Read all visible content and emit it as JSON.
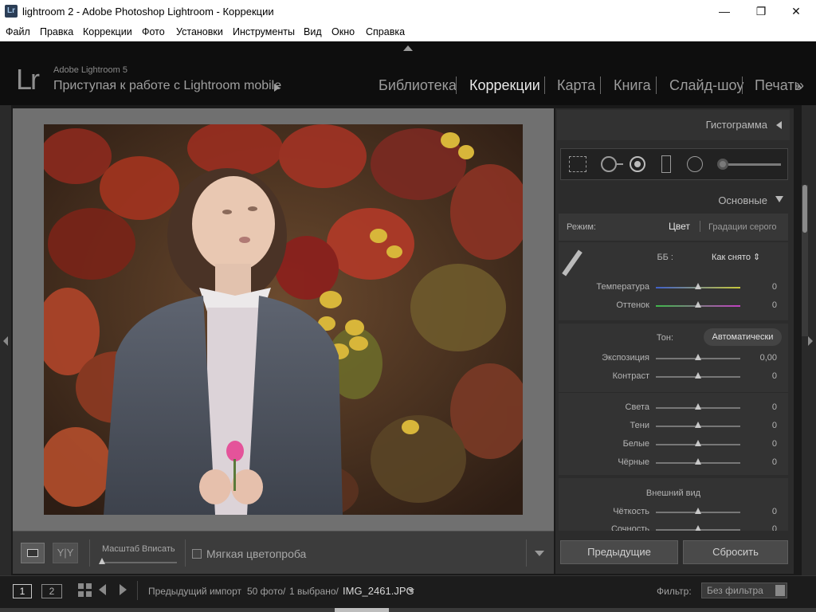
{
  "window": {
    "title": "lightroom 2 - Adobe Photoshop Lightroom - Коррекции",
    "app_icon": "Lr",
    "minimize": "—",
    "maximize": "❐",
    "close": "✕"
  },
  "menu": [
    "Файл",
    "Правка",
    "Коррекции",
    "Фото",
    "Установки",
    "Инструменты",
    "Вид",
    "Окно",
    "Справка"
  ],
  "header": {
    "logo": "Lr",
    "version": "Adobe Lightroom 5",
    "identity": "Приступая к работе с Lightroom mobile",
    "modules": [
      {
        "label": "Библиотека",
        "active": false
      },
      {
        "label": "Коррекции",
        "active": true
      },
      {
        "label": "Карта",
        "active": false
      },
      {
        "label": "Книга",
        "active": false
      },
      {
        "label": "Слайд-шоу",
        "active": false
      },
      {
        "label": "Печать",
        "active": false
      }
    ],
    "more": "»"
  },
  "panel": {
    "histogram_title": "Гистограмма",
    "basic_title": "Основные",
    "treatment": {
      "label": "Режим:",
      "color": "Цвет",
      "bw": "Градации серого"
    },
    "wb": {
      "label": "ББ :",
      "value": "Как снято ⇕"
    },
    "temp_label": "Температура",
    "temp_value": "0",
    "tint_label": "Оттенок",
    "tint_value": "0",
    "tone_label": "Тон:",
    "auto_label": "Автоматически",
    "exposure_label": "Экспозиция",
    "exposure_value": "0,00",
    "contrast_label": "Контраст",
    "contrast_value": "0",
    "highlights_label": "Света",
    "highlights_value": "0",
    "shadows_label": "Тени",
    "shadows_value": "0",
    "whites_label": "Белые",
    "whites_value": "0",
    "blacks_label": "Чёрные",
    "blacks_value": "0",
    "presence_label": "Внешний вид",
    "clarity_label": "Чёткость",
    "clarity_value": "0",
    "vibrance_label": "Сочность",
    "vibrance_value": "0",
    "previous_button": "Предыдущие",
    "reset_button": "Сбросить"
  },
  "toolbar": {
    "zoom_label": "Масштаб",
    "zoom_value": "Вписать",
    "softproof_label": "Мягкая цветопроба",
    "yy_label": "Y|Y"
  },
  "filmbar": {
    "screen1": "1",
    "screen2": "2",
    "source": "Предыдущий импорт",
    "count": "50 фото/",
    "selected": "1 выбрано/",
    "filename": "IMG_2461.JPG",
    "filter_label": "Фильтр:",
    "filter_value": "Без фильтра"
  },
  "colors": {
    "accent_temp_start": "#3f5fc8",
    "accent_temp_end": "#c8c83a",
    "accent_tint_start": "#3fb84a",
    "accent_tint_end": "#c23fc2"
  },
  "icons": {
    "crop": "crop-overlay-icon",
    "spot": "spot-removal-icon",
    "redeye": "red-eye-icon",
    "graduated": "graduated-filter-icon",
    "radial": "radial-filter-icon",
    "brush": "adjustment-brush-icon",
    "eyedropper": "eyedropper-icon"
  }
}
